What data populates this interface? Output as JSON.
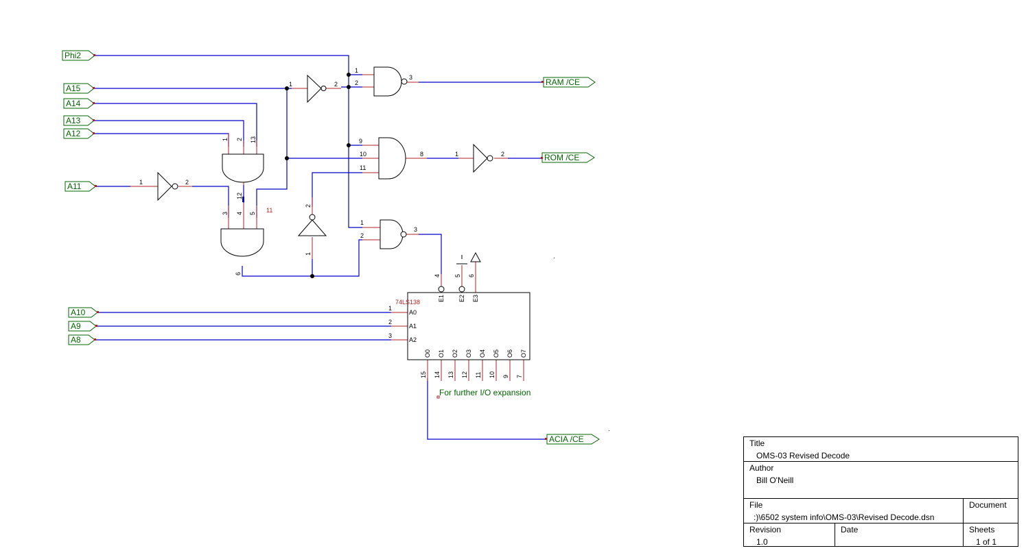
{
  "ports": {
    "phi2": "Phi2",
    "a15": "A15",
    "a14": "A14",
    "a13": "A13",
    "a12": "A12",
    "a11": "A11",
    "a10": "A10",
    "a9": "A9",
    "a8": "A8",
    "ram_ce": "RAM /CE",
    "rom_ce": "ROM /CE",
    "acia_ce": "ACIA /CE"
  },
  "decoder": {
    "part": "74LS138",
    "inputs": [
      "A0",
      "A1",
      "A2"
    ],
    "enables": [
      "E1",
      "E2",
      "E3"
    ],
    "outputs": [
      "O0",
      "O1",
      "O2",
      "O3",
      "O4",
      "O5",
      "O6",
      "O7"
    ],
    "input_pins": [
      "1",
      "2",
      "3"
    ],
    "enable_pins": [
      "4",
      "5",
      "6"
    ],
    "output_pins": [
      "15",
      "14",
      "13",
      "12",
      "11",
      "10",
      "9",
      "7"
    ]
  },
  "pins": {
    "inv1_in": "1",
    "inv1_out": "2",
    "ram_in1": "1",
    "ram_in2": "2",
    "ram_out": "3",
    "rom_in9": "9",
    "rom_in10": "10",
    "rom_in11": "11",
    "rom_out": "8",
    "inv2_in": "1",
    "inv2_out": "2",
    "and_top_1": "1",
    "and_top_2": "2",
    "and_top_13": "13",
    "and_top_12": "12",
    "inv3_in": "1",
    "inv3_out": "2",
    "and_bot_3": "3",
    "and_bot_4": "4",
    "and_bot_5": "5",
    "and_bot_6": "6",
    "extra_11": "11",
    "inv4_in": "1",
    "inv4_out": "2",
    "nand3_in1": "1",
    "nand3_in2": "2",
    "nand3_out": "3"
  },
  "note": "For further I/O expansion",
  "title_block": {
    "title_label": "Title",
    "title_value": "OMS-03 Revised Decode",
    "author_label": "Author",
    "author_value": "Bill O'Neill",
    "file_label": "File",
    "file_value": ":)\\6502 system info\\OMS-03\\Revised Decode.dsn",
    "document_label": "Document",
    "revision_label": "Revision",
    "revision_value": "1.0",
    "date_label": "Date",
    "sheets_label": "Sheets",
    "sheets_value": "1 of 1"
  },
  "colors": {
    "wire": "#0000cc",
    "pin": "#b22222",
    "label": "#006400",
    "junction": "#000000"
  }
}
